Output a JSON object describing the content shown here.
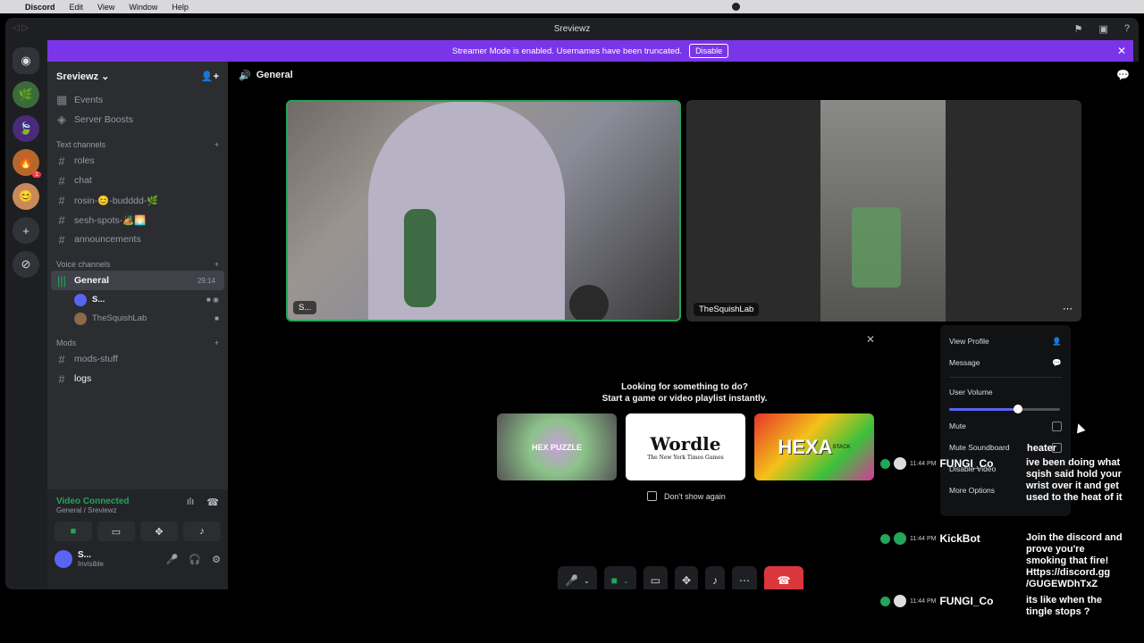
{
  "menubar": {
    "app": "Discord",
    "items": [
      "Edit",
      "View",
      "Window",
      "Help"
    ]
  },
  "window": {
    "title": "Sreviewz"
  },
  "banner": {
    "text": "Streamer Mode is enabled. Usernames have been truncated.",
    "button": "Disable"
  },
  "server": {
    "name": "Sreviewz ⌄"
  },
  "nav": {
    "events": "Events",
    "boosts": "Server Boosts"
  },
  "categories": {
    "text": "Text channels",
    "voice": "Voice channels",
    "mods": "Mods"
  },
  "text_channels": [
    "roles",
    "chat",
    "rosin-😊-budddd-🌿",
    "sesh-spots-🏕️🌅",
    "announcements"
  ],
  "voice_channel": {
    "name": "General",
    "timer": "29:14"
  },
  "voice_users": [
    "S...",
    "TheSquishLab"
  ],
  "mod_channels": [
    "mods-stuff",
    "logs"
  ],
  "status": {
    "connected": "Video Connected",
    "location": "General / Sreviewz"
  },
  "user": {
    "name": "S...",
    "status": "Invisible"
  },
  "stage": {
    "channel": "General"
  },
  "tiles": {
    "left_tag": "S...",
    "right_tag": "TheSquishLab"
  },
  "activity": {
    "title1": "Looking for something to do?",
    "title2": "Start a game or video playlist instantly.",
    "cards": [
      "HEX PUZZLE",
      "Wordle",
      "HEXA"
    ],
    "card2_sub": "The New York Times Games",
    "card3_sub": "STACK",
    "checkbox": "Don't show again"
  },
  "context_menu": {
    "view_profile": "View Profile",
    "message": "Message",
    "volume_label": "User Volume",
    "volume_level": 0.62,
    "mute": "Mute",
    "mute_soundboard": "Mute Soundboard",
    "disable_video": "Disable Video",
    "more": "More Options"
  },
  "chat": {
    "heater": "heater",
    "messages": [
      {
        "time": "11:44 PM",
        "name": "FUNGI_Co",
        "text": "ive been doing what sqish said hold your wrist over it and get used to the heat of it"
      },
      {
        "time": "11:44 PM",
        "name": "KickBot",
        "text": "Join the discord and prove you're smoking that fire! Https://discord.gg /GUGEWDhTxZ"
      },
      {
        "time": "11:44 PM",
        "name": "FUNGI_Co",
        "text": "its like when the tingle stops ?"
      }
    ]
  },
  "colors": {
    "accent": "#5865f2",
    "banner": "#7a35e8",
    "online": "#23a55a",
    "hangup": "#da373c"
  }
}
